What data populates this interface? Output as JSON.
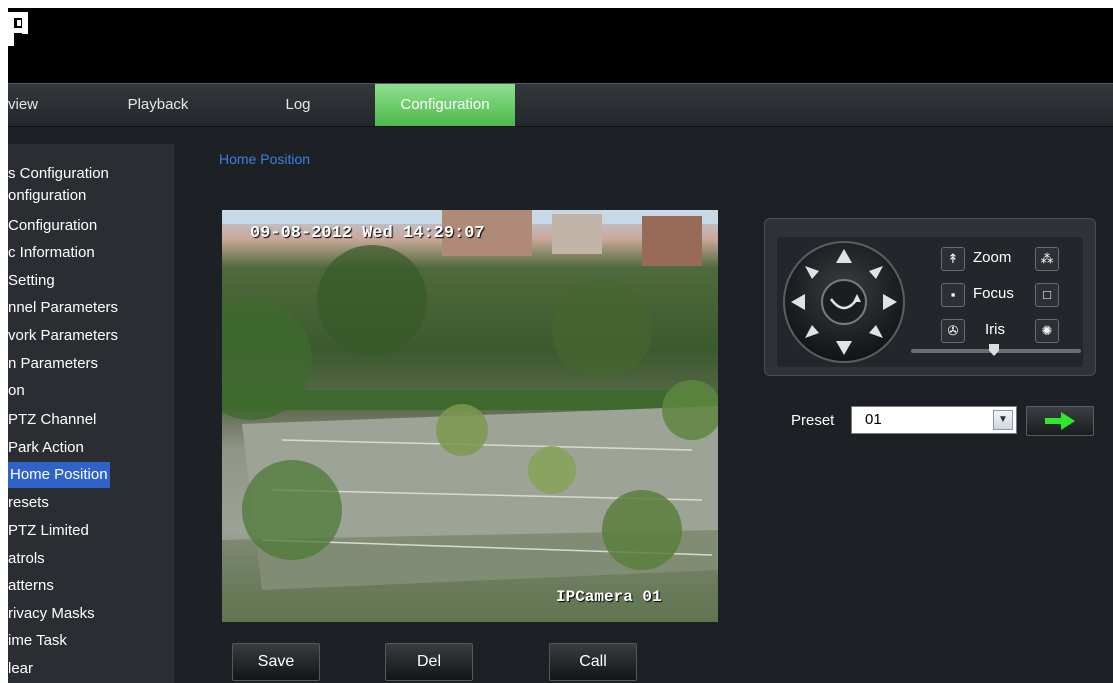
{
  "nav": {
    "tabs": [
      "view",
      "Playback",
      "Log",
      "Configuration"
    ],
    "active": "Configuration"
  },
  "sidebar": {
    "items": [
      "s Configuration",
      "onfiguration",
      " Configuration",
      "c Information",
      " Setting",
      "nnel Parameters",
      "vork Parameters",
      "n Parameters",
      "on",
      "PTZ Channel",
      "Park Action",
      "Home Position",
      "resets",
      "PTZ Limited",
      "atrols",
      "atterns",
      "rivacy Masks",
      "ime Task",
      "lear"
    ],
    "active_index": 11
  },
  "breadcrumb": "Home Position",
  "video": {
    "timestamp": "09-08-2012 Wed 14:29:07",
    "camera_name": "IPCamera 01"
  },
  "buttons": {
    "save": "Save",
    "del": "Del",
    "call": "Call"
  },
  "ptz": {
    "zoom_label": "Zoom",
    "focus_label": "Focus",
    "iris_label": "Iris",
    "speed_level": 0.55,
    "icons": [
      "zoom-in-icon",
      "zoom-out-icon",
      "focus-near-icon",
      "focus-far-icon",
      "iris-open-icon",
      "iris-close-icon"
    ]
  },
  "preset": {
    "label": "Preset",
    "value": "01"
  },
  "colors": {
    "active_tab": "#5cc85c",
    "active_sidebar": "#2f63c8",
    "breadcrumb": "#3c7fe0",
    "go_arrow": "#2ee82e"
  }
}
